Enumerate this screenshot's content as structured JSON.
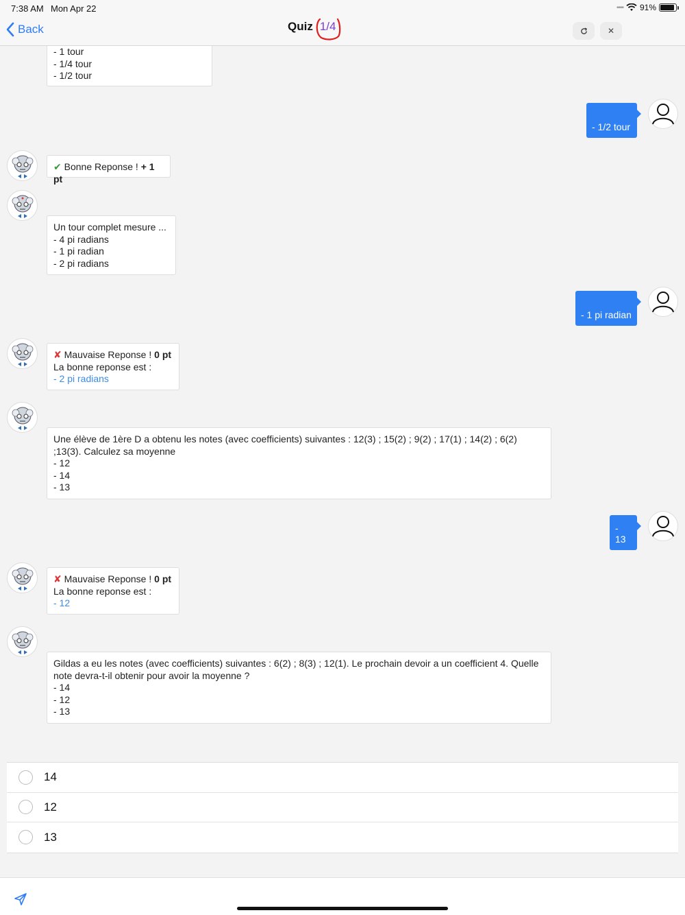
{
  "status_bar": {
    "time": "7:38 AM",
    "date": "Mon Apr 22",
    "battery": "91%",
    "battery_level": 0.91,
    "icons": [
      "signal-dots-icon",
      "wifi-icon",
      "battery-icon"
    ]
  },
  "nav": {
    "back_label": "Back",
    "title": "Quiz",
    "counter": "1/4",
    "refresh_icon": "refresh-icon",
    "close_icon": "close-icon",
    "accent": "#2f7cf6",
    "counter_color": "#7b3fd0",
    "circle_color": "#e01e1e"
  },
  "chat": {
    "partial_question": {
      "lines": [
        "- 1 tour",
        "- 1/4 tour",
        "- 1/2 tour"
      ]
    },
    "user_answer_1": "- 1/2 tour",
    "feedback_1": {
      "text": "Bonne Reponse ! ",
      "points": "+ 1 pt"
    },
    "question_2": {
      "lines": [
        "Un tour complet mesure ...",
        "- 4 pi radians",
        "- 1 pi radian",
        "- 2 pi radians"
      ]
    },
    "user_answer_2": "- 1 pi radian",
    "feedback_2": {
      "text": "Mauvaise Reponse ! ",
      "points": "0 pt",
      "correct_intro": "La bonne reponse est :",
      "correct_answer": "- 2 pi radians"
    },
    "question_3": {
      "lines": [
        "Une élève de 1ère D a obtenu les notes (avec coefficients) suivantes : 12(3) ; 15(2) ; 9(2) ; 17(1) ; 14(2) ; 6(2)",
        ";13(3). Calculez sa moyenne",
        "- 12",
        "- 14",
        "- 13"
      ]
    },
    "user_answer_3": "- 13",
    "feedback_3": {
      "text": "Mauvaise Reponse ! ",
      "points": "0 pt",
      "correct_intro": "La bonne reponse est :",
      "correct_answer": "- 12"
    },
    "question_4": {
      "lines": [
        "Gildas a eu les notes (avec coefficients) suivantes : 6(2) ; 8(3) ; 12(1). Le prochain devoir a un coefficient 4. Quelle",
        "note devra-t-il obtenir pour avoir la moyenne ?",
        "- 14",
        "- 12",
        "- 13"
      ]
    }
  },
  "options": [
    "14",
    "12",
    "13"
  ],
  "bottom": {
    "send_icon": "send-icon"
  }
}
